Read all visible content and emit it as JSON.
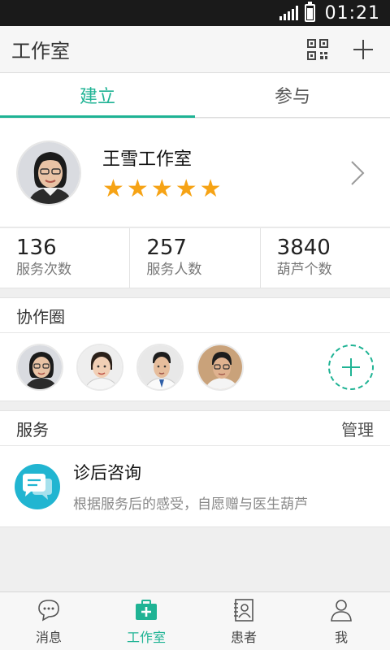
{
  "status_bar": {
    "time": "01:21"
  },
  "app_bar": {
    "title": "工作室"
  },
  "tabs": [
    {
      "label": "建立",
      "active": true
    },
    {
      "label": "参与",
      "active": false
    }
  ],
  "profile": {
    "name": "王雪工作室",
    "rating": 5,
    "rating_max": 5
  },
  "stats": [
    {
      "value": "136",
      "label": "服务次数"
    },
    {
      "value": "257",
      "label": "服务人数"
    },
    {
      "value": "3840",
      "label": "葫芦个数"
    }
  ],
  "collab": {
    "title": "协作圈",
    "members": 4
  },
  "services": {
    "title": "服务",
    "manage_label": "管理",
    "items": [
      {
        "title": "诊后咨询",
        "desc": "根据服务后的感受，自愿赠与医生葫芦",
        "icon": "chat-bubble-icon"
      }
    ]
  },
  "bottom_nav": [
    {
      "label": "消息",
      "icon": "chat-icon",
      "active": false
    },
    {
      "label": "工作室",
      "icon": "medical-bag-icon",
      "active": true
    },
    {
      "label": "患者",
      "icon": "contacts-book-icon",
      "active": false
    },
    {
      "label": "我",
      "icon": "person-icon",
      "active": false
    }
  ],
  "colors": {
    "accent": "#1fb394",
    "star": "#f6a315",
    "service_icon": "#21b5d1"
  }
}
